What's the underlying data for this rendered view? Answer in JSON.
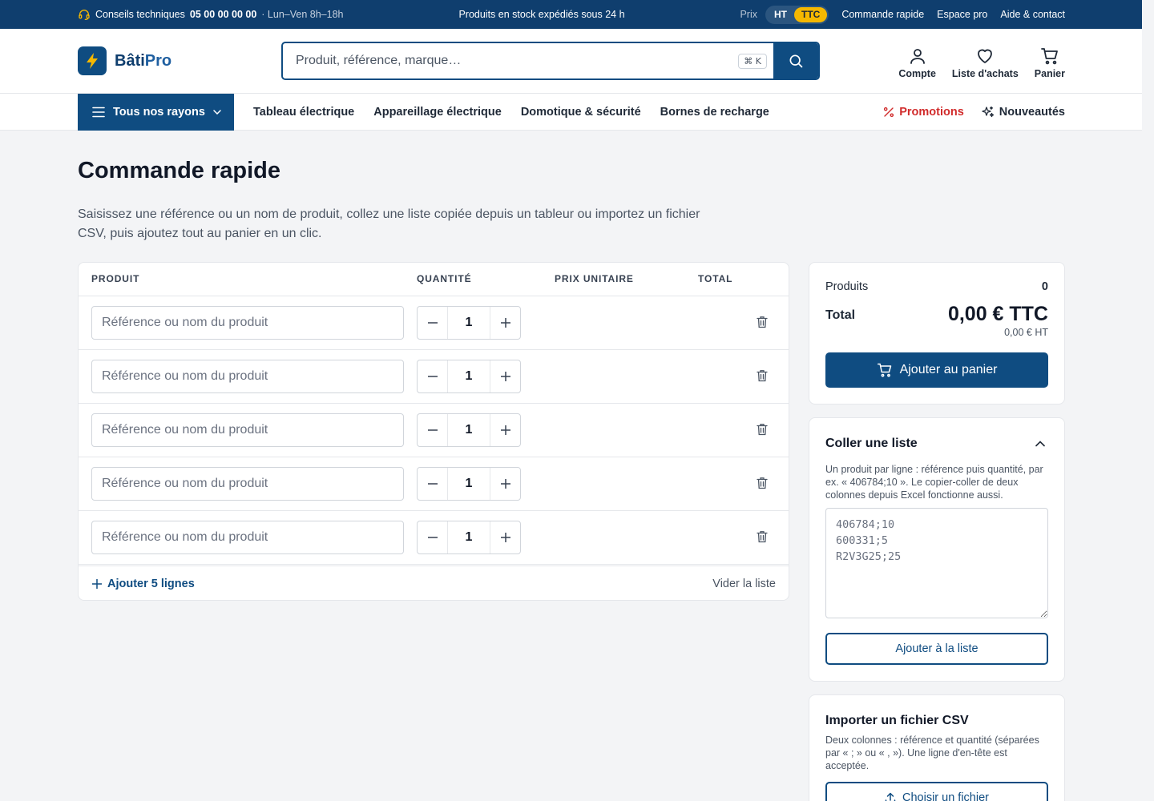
{
  "topbar": {
    "support_label": "Conseils techniques",
    "phone": "05 00 00 00 00",
    "hours": "· Lun–Ven 8h–18h",
    "shipping_message": "Produits en stock expédiés sous 24 h",
    "price_label": "Prix",
    "price_ht": "HT",
    "price_ttc": "TTC",
    "price_mode_selected": "TTC",
    "links": [
      "Commande rapide",
      "Espace pro",
      "Aide & contact"
    ]
  },
  "brand": {
    "name_a": "Bâti",
    "name_b": "Pro",
    "accent": "#0f4c81",
    "highlight": "#f5b800"
  },
  "search": {
    "placeholder": "Produit, référence, marque…",
    "shortcut": "⌘ K"
  },
  "header_actions": {
    "account": "Compte",
    "wishlist": "Liste d'achats",
    "cart": "Panier"
  },
  "nav": {
    "all_departments": "Tous nos rayons",
    "links": [
      "Tableau électrique",
      "Appareillage électrique",
      "Domotique & sécurité",
      "Bornes de recharge"
    ],
    "promotions": "Promotions",
    "new": "Nouveautés"
  },
  "page": {
    "title": "Commande rapide",
    "intro": "Saisissez une référence ou un nom de produit, collez une liste copiée depuis un tableur ou importez un fichier CSV, puis ajoutez tout au panier en un clic."
  },
  "order_table": {
    "headers": {
      "product": "PRODUIT",
      "quantity": "QUANTITÉ",
      "unit_price": "PRIX UNITAIRE",
      "total": "TOTAL"
    },
    "product_placeholder": "Référence ou nom du produit",
    "rows": [
      {
        "quantity": "1"
      },
      {
        "quantity": "1"
      },
      {
        "quantity": "1"
      },
      {
        "quantity": "1"
      },
      {
        "quantity": "1"
      }
    ],
    "add_lines": "Ajouter 5 lignes",
    "clear": "Vider la liste"
  },
  "summary": {
    "products_label": "Produits",
    "products_count": "0",
    "total_label": "Total",
    "total_ttc": "0,00 € TTC",
    "total_ht": "0,00 € HT",
    "add_to_cart": "Ajouter au panier"
  },
  "paste_list": {
    "title": "Coller une liste",
    "help": "Un produit par ligne : référence puis quantité, par ex. « 406784;10 ». Le copier-coller de deux colonnes depuis Excel fonctionne aussi.",
    "placeholder": "406784;10\n600331;5\nR2V3G25;25",
    "button": "Ajouter à la liste"
  },
  "csv_import": {
    "title": "Importer un fichier CSV",
    "help": "Deux colonnes : référence et quantité (séparées par « ; » ou « , »). Une ligne d'en-tête est acceptée.",
    "button": "Choisir un fichier"
  }
}
